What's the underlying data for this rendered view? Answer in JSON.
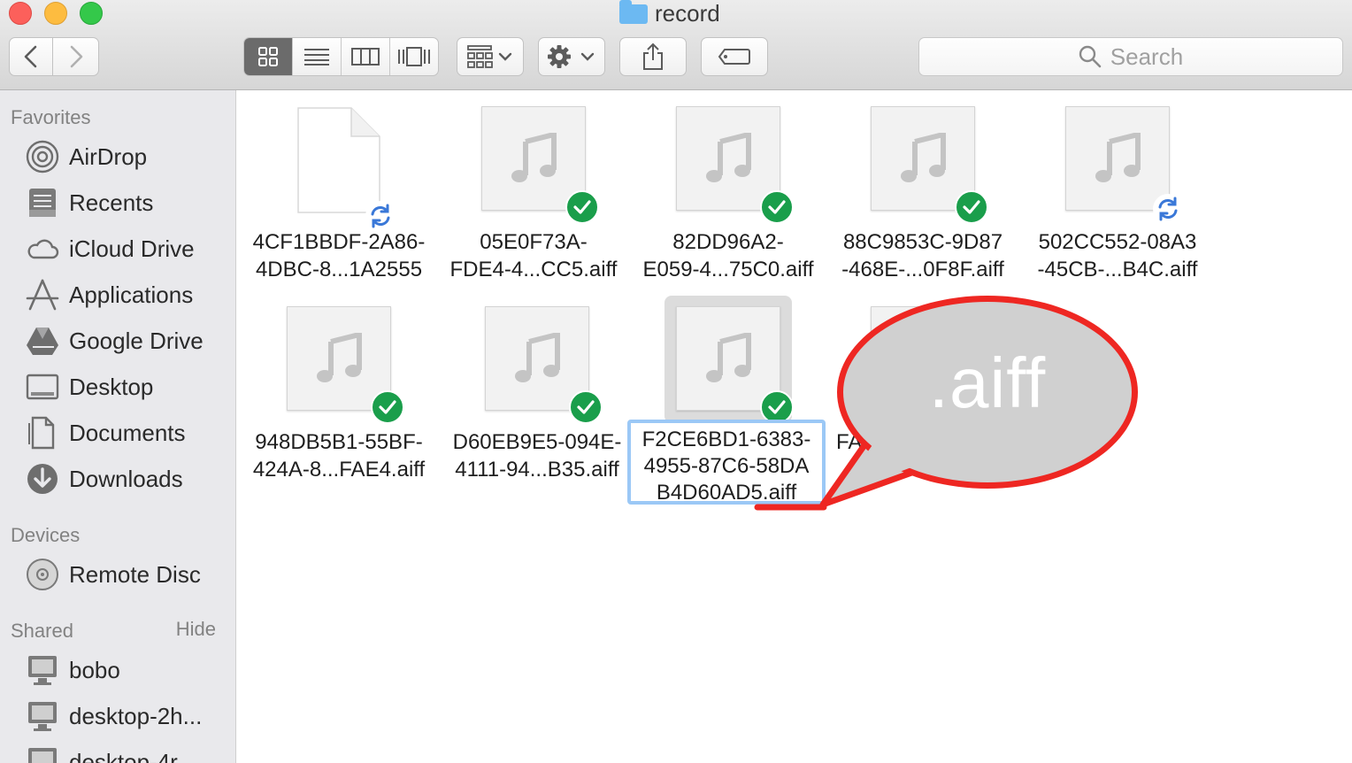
{
  "window": {
    "title": "record"
  },
  "toolbar": {
    "back": "back",
    "forward": "forward",
    "views": [
      "icon",
      "list",
      "column",
      "cover-flow"
    ],
    "active_view": "icon",
    "search_placeholder": "Search"
  },
  "sidebar": {
    "favorites_heading": "Favorites",
    "favorites": [
      {
        "label": "AirDrop",
        "icon": "airdrop-icon"
      },
      {
        "label": "Recents",
        "icon": "recents-icon"
      },
      {
        "label": "iCloud Drive",
        "icon": "cloud-icon"
      },
      {
        "label": "Applications",
        "icon": "applications-icon"
      },
      {
        "label": "Google Drive",
        "icon": "google-drive-icon"
      },
      {
        "label": "Desktop",
        "icon": "desktop-icon"
      },
      {
        "label": "Documents",
        "icon": "documents-icon"
      },
      {
        "label": "Downloads",
        "icon": "downloads-icon"
      }
    ],
    "devices_heading": "Devices",
    "devices": [
      {
        "label": "Remote Disc",
        "icon": "disc-icon"
      }
    ],
    "shared_heading": "Shared",
    "shared_hide": "Hide",
    "shared": [
      {
        "label": "bobo",
        "icon": "computer-icon"
      },
      {
        "label": "desktop-2h...",
        "icon": "computer-icon"
      },
      {
        "label": "desktop-4r...",
        "icon": "computer-icon"
      }
    ]
  },
  "files": [
    {
      "line1": "4CF1BBDF-2A86-",
      "line2": "4DBC-8...1A2555",
      "type": "blank",
      "status": "syncing"
    },
    {
      "line1": "05E0F73A-",
      "line2": "FDE4-4...CC5.aiff",
      "type": "audio",
      "status": "synced"
    },
    {
      "line1": "82DD96A2-",
      "line2": "E059-4...75C0.aiff",
      "type": "audio",
      "status": "synced"
    },
    {
      "line1": "88C9853C-9D87",
      "line2": "-468E-...0F8F.aiff",
      "type": "audio",
      "status": "synced"
    },
    {
      "line1": "502CC552-08A3",
      "line2": "-45CB-...B4C.aiff",
      "type": "audio",
      "status": "syncing"
    },
    {
      "line1": "948DB5B1-55BF-",
      "line2": "424A-8...FAE4.aiff",
      "type": "audio",
      "status": "synced"
    },
    {
      "line1": "D60EB9E5-094E-",
      "line2": "4111-94...B35.aiff",
      "type": "audio",
      "status": "synced"
    }
  ],
  "selected_file": {
    "line1": "F2CE6BD1-6383-",
    "line2": "4955-87C6-58DA",
    "line3": "B4D60AD5.aiff",
    "type": "audio",
    "status": "synced"
  },
  "partial_file": {
    "line1": "FA",
    "line2": "-"
  },
  "annotation": {
    "text": ".aiff",
    "color": "#ee2722"
  }
}
